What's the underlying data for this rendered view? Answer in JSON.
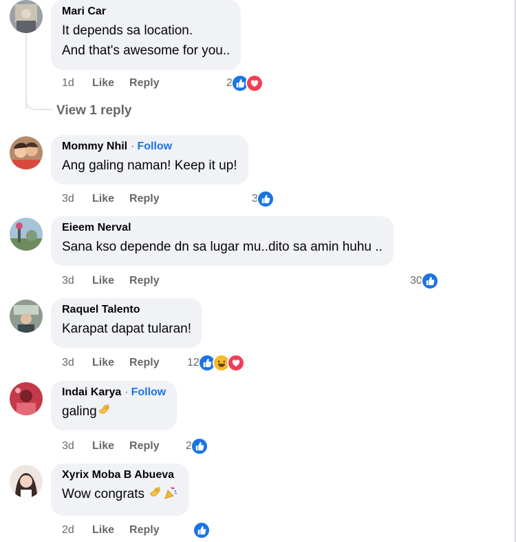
{
  "comments": [
    {
      "author": "Mari Car",
      "follow": "",
      "lines": [
        "It depends sa location.",
        "And that's awesome for you.."
      ],
      "time": "1d",
      "like_label": "Like",
      "reply_label": "Reply",
      "reaction_count": "2",
      "reactions": [
        "like-icon",
        "love-icon"
      ]
    },
    {
      "author": "Mommy Nhil",
      "follow": "Follow",
      "lines": [
        "Ang galing naman! Keep it up!"
      ],
      "time": "3d",
      "like_label": "Like",
      "reply_label": "Reply",
      "reaction_count": "3",
      "reactions": [
        "like-icon"
      ]
    },
    {
      "author": "Eieem Nerval",
      "follow": "",
      "lines": [
        "Sana kso depende dn sa lugar mu..dito sa amin huhu .."
      ],
      "time": "3d",
      "like_label": "Like",
      "reply_label": "Reply",
      "reaction_count": "30",
      "reactions": [
        "like-icon"
      ]
    },
    {
      "author": "Raquel Talento",
      "follow": "",
      "lines": [
        "Karapat dapat tularan!"
      ],
      "time": "3d",
      "like_label": "Like",
      "reply_label": "Reply",
      "reaction_count": "12",
      "reactions": [
        "like-icon",
        "haha-icon",
        "love-icon"
      ]
    },
    {
      "author": "Indai Karya",
      "follow": "Follow",
      "lines": [
        "galing"
      ],
      "time": "3d",
      "like_label": "Like",
      "reply_label": "Reply",
      "reaction_count": "2",
      "reactions": [
        "like-icon"
      ]
    },
    {
      "author": "Xyrix Moba B Abueva",
      "follow": "",
      "lines": [
        "Wow congrats "
      ],
      "time": "2d",
      "like_label": "Like",
      "reply_label": "Reply",
      "reaction_count": "",
      "reactions": [
        "like-icon"
      ]
    }
  ],
  "view_replies_label": "View 1 reply",
  "follow_dot": "·",
  "colors": {
    "bubble": "#f0f2f5",
    "meta_text": "#65676b",
    "follow_link": "#1a74e4",
    "like_reaction": "#1b74e4",
    "love_reaction": "#f33e58",
    "haha_reaction": "#f7b928"
  }
}
